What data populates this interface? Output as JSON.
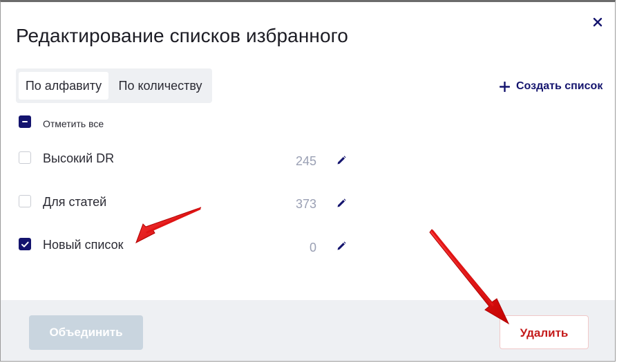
{
  "dialog": {
    "title": "Редактирование списков избранного",
    "close_icon": "close-icon"
  },
  "sort_tabs": [
    {
      "label": "По алфавиту",
      "active": true
    },
    {
      "label": "По количеству",
      "active": false
    }
  ],
  "create_list": {
    "label": "Создать список",
    "icon": "plus-icon"
  },
  "select_all": {
    "label": "Отметить все",
    "state": "indeterminate"
  },
  "lists": [
    {
      "name": "Высокий DR",
      "count": "245",
      "checked": false
    },
    {
      "name": "Для статей",
      "count": "373",
      "checked": false
    },
    {
      "name": "Новый список",
      "count": "0",
      "checked": true
    }
  ],
  "footer": {
    "merge_label": "Объединить",
    "merge_enabled": false,
    "delete_label": "Удалить"
  },
  "colors": {
    "accent": "#14146e",
    "danger": "#c41a1a",
    "annotation_arrow": "#e01414"
  }
}
